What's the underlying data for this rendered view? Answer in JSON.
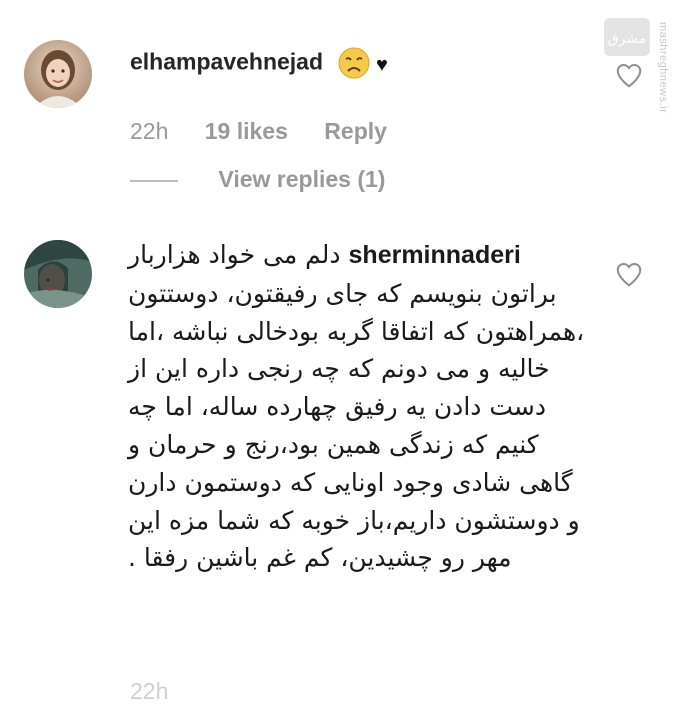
{
  "watermark": {
    "brand_text": "mashreghnews.ir",
    "logo_text": "مشرق"
  },
  "comments": [
    {
      "username": "elhampavehnejad",
      "emoji": "disappointed-face",
      "suffix_heart": "♥",
      "time": "22h",
      "likes": "19 likes",
      "reply_label": "Reply",
      "view_replies": "View replies (1)"
    },
    {
      "username": "sherminnaderi",
      "text": "دلم می خواد هزاربار براتون بنویسم که جای رفیقتون، دوستتون ،همراهتون که اتفاقا گربه بودخالی نباشه ،اما خالیه و می دونم که چه رنجی داره این از دست دادن یه رفیق چهارده ساله، اما چه کنیم که زندگی همین بود،رنج و حرمان و گاهی شادی وجود اونایی که دوستمون دارن و دوستشون داریم،باز خوبه که شما مزه این مهر رو چشیدین، کم غم باشین رفقا ."
    }
  ],
  "next_meta": "22h"
}
